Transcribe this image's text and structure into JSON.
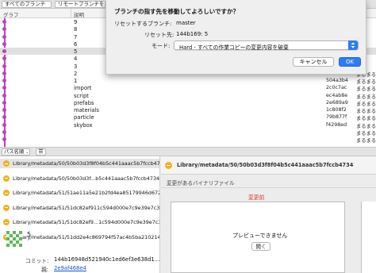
{
  "toolbar": {
    "all_branches": "すべてのブランチ",
    "remote_branches": "リモートブランチを表示",
    "show_arrow": "⌄"
  },
  "table": {
    "col_graph": "グラフ",
    "col_description": "説明",
    "rows": [
      {
        "message": "9",
        "hash": "",
        "author": ""
      },
      {
        "message": "8",
        "hash": "",
        "author": ""
      },
      {
        "message": "7",
        "hash": "",
        "author": ""
      },
      {
        "message": "6",
        "hash": "",
        "author": ""
      },
      {
        "message": "5",
        "hash": "",
        "author": ""
      },
      {
        "message": "4",
        "hash": "",
        "author": ""
      },
      {
        "message": "3",
        "hash": "",
        "author": ""
      },
      {
        "message": "2",
        "hash": "74f70",
        "author": "まるまる"
      },
      {
        "message": "1",
        "hash": "504a3b4",
        "author": "まるまる"
      },
      {
        "message": "import",
        "hash": "2c0c7ac",
        "author": "まるまる"
      },
      {
        "message": "script",
        "hash": "ec4ab8e",
        "author": "まるまる"
      },
      {
        "message": "prefabs",
        "hash": "2e689a9",
        "author": "まるまる"
      },
      {
        "message": "materials",
        "hash": "1c808f2",
        "author": "まるまる"
      },
      {
        "message": "particle",
        "hash": "79b877f",
        "author": "まるまる"
      },
      {
        "message": "skybox",
        "hash": "f4298ed",
        "author": "まるまる"
      },
      {
        "message": "",
        "hash": "",
        "author": "まるまる"
      },
      {
        "message": "",
        "hash": "",
        "author": "まるまる"
      }
    ]
  },
  "dialog": {
    "title": "ブランチの指す先を移動してよろしいですか？",
    "branch_label": "リセットするブランチ:",
    "branch_value": "master",
    "target_label": "リセット先:",
    "target_value": "144b169: 5",
    "mode_label": "モード:",
    "mode_value": "Hard - すべての作業コピーの変更内容を破棄",
    "cancel": "キャンセル",
    "ok": "OK"
  },
  "bottom_toolbar": {
    "path_select": "パス名順",
    "list_icon": "☰"
  },
  "files": [
    "Library/metadata/50/50b03d3f8f04b5c441aaac5b7fccb4734",
    "Library/metadata/50/50b03d3f...b5c441aaac5b7fccb4734.info",
    "Library/metadata/51/51ae11a5e21b2fd4ea85179946d672a",
    "Library/metadata/51/51dc82ef911c594d000e7c9e39e7c39",
    "Library/metadata/51/51dc82ef9...1c594d000e7c9e39e7c39.info",
    "Library/metadata/51/51dd2e4c869794f57ac4b5ba210214"
  ],
  "commit": {
    "message": "5",
    "commit_label": "コミット:",
    "commit_value": "144b16948d521940c1ed6ef3e638d1...",
    "parent_label": "親:",
    "parent_value": "2e9af468e4"
  },
  "right_pane": {
    "file_path": "Library/metadata/50/50b03d3f8f04b5c441aaac5b7fccb4734",
    "binary_label": "変更があるバイナリファイル",
    "before_label": "変更前",
    "preview_text": "プレビューできません",
    "open_button": "開く"
  },
  "colors": {
    "graph": "#c23fbf",
    "accent": "#2f7bf2",
    "file_icon": "#f0b31d",
    "before_label": "#d33a2c"
  }
}
